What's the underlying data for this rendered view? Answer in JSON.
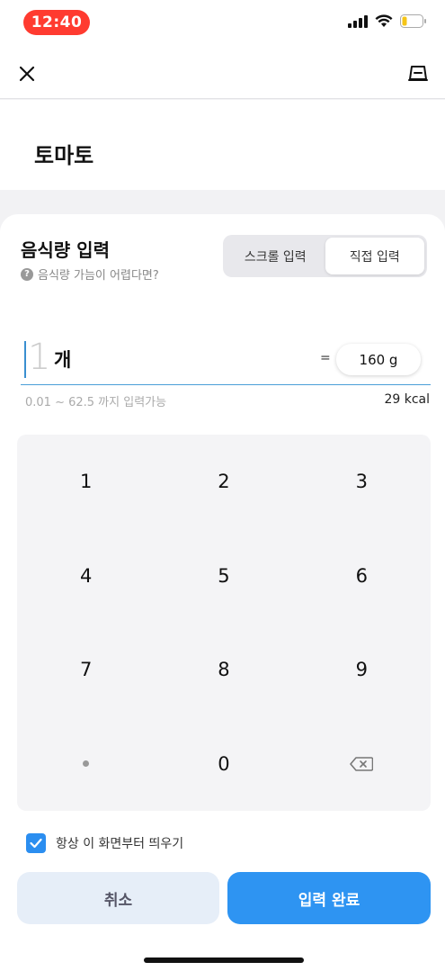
{
  "status_bar": {
    "time": "12:40"
  },
  "top_bar": {
    "close_icon": "close-icon",
    "scale_icon": "scale-icon"
  },
  "food": {
    "name": "토마토"
  },
  "amount_section": {
    "title": "음식량 입력",
    "help_text": "음식량 가늠이 어렵다면?",
    "modes": [
      "스크롤 입력",
      "직접 입력"
    ],
    "active_mode": "직접 입력"
  },
  "input": {
    "quantity_placeholder": "1",
    "unit": "개",
    "equals": "=",
    "grams": "160 g",
    "range_hint": "0.01 ~ 62.5 까지 입력가능",
    "kcal": "29 kcal"
  },
  "keypad": {
    "keys": [
      "1",
      "2",
      "3",
      "4",
      "5",
      "6",
      "7",
      "8",
      "9",
      "·",
      "0",
      "⌫"
    ]
  },
  "options": {
    "always_show_label": "항상 이 화면부터 띄우기",
    "always_show_checked": true
  },
  "buttons": {
    "cancel": "취소",
    "done": "입력 완료"
  },
  "colors": {
    "accent": "#2e94f2",
    "time_pill": "#ff3b30",
    "input_underline": "#4a9fd8"
  }
}
